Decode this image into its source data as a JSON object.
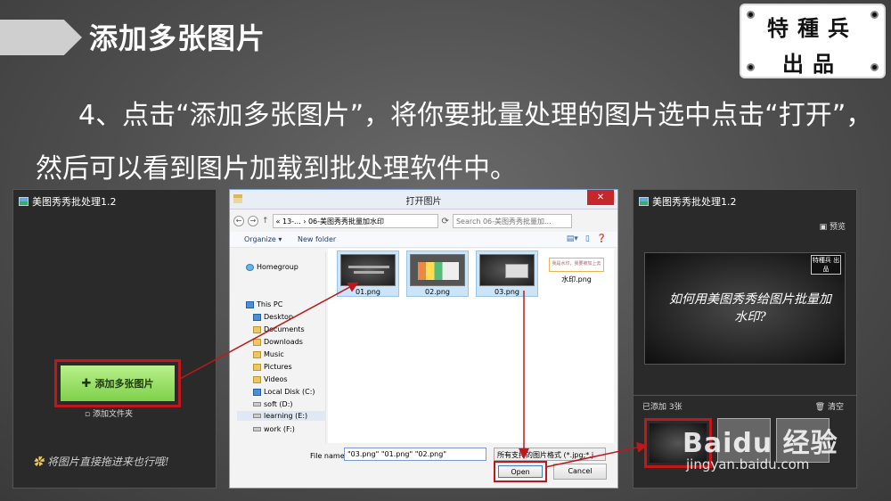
{
  "slide": {
    "title": "添加多张图片",
    "instruction": "4、点击“添加多张图片”，将你要批量处理的图片选中点击“打开”，然后可以看到图片加载到批处理软件中。",
    "stamp_line1": "特種兵",
    "stamp_line2": "出品"
  },
  "left_app": {
    "title": "美图秀秀批处理1.2",
    "add_button": "添加多张图片",
    "add_folder": "添加文件夹",
    "drag_hint": "将图片直接拖进来也行哦!"
  },
  "dialog": {
    "title": "打开图片",
    "address": "« 13-... › 06-美图秀秀批量加水印",
    "search_placeholder": "Search 06-美图秀秀批量加...",
    "organize": "Organize ▾",
    "new_folder": "New folder",
    "nav": [
      "Homegroup",
      "This PC",
      "Desktop",
      "Documents",
      "Downloads",
      "Music",
      "Pictures",
      "Videos",
      "Local Disk (C:)",
      "soft (D:)",
      "learning (E:)",
      "work (F:)"
    ],
    "files": [
      {
        "name": "01.png",
        "selected": true
      },
      {
        "name": "02.png",
        "selected": true
      },
      {
        "name": "03.png",
        "selected": true
      },
      {
        "name": "水印.png",
        "selected": false
      }
    ],
    "watermark_thumb_text": "我是水印，我要被加上去",
    "filename_label": "File name:",
    "filename_value": "\"03.png\" \"01.png\" \"02.png\"",
    "filetype": "所有支持的图片格式 (*.jpg;*.j",
    "open": "Open",
    "cancel": "Cancel"
  },
  "right_app": {
    "title": "美图秀秀批处理1.2",
    "preview_label": "预览",
    "preview_text": "如何用美图秀秀给图片批量加水印?",
    "preview_stamp": "特種兵 出品",
    "added_count": "已添加 3张",
    "clear": "清空"
  },
  "watermark": {
    "brand": "Baidu 经验",
    "url": "jingyan.baidu.com"
  },
  "colors": {
    "highlight_red": "#c0181a",
    "add_button_green": "#8fdc55"
  }
}
